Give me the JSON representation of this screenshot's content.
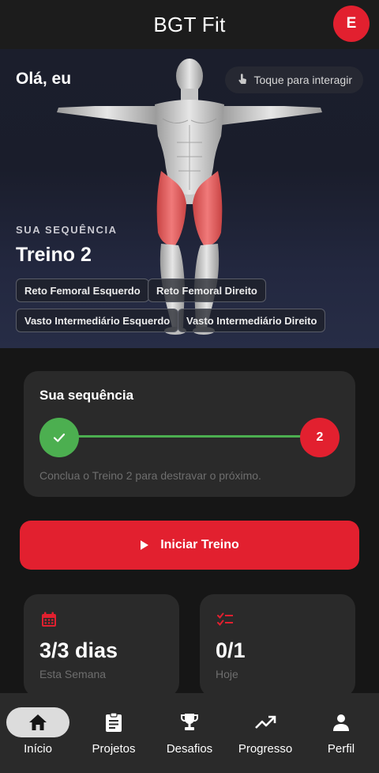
{
  "app": {
    "title": "BGT Fit",
    "avatar_initial": "E"
  },
  "hero": {
    "greeting": "Olá, eu",
    "tap_hint": "Toque para interagir",
    "sequence_label": "SUA SEQUÊNCIA",
    "workout_name": "Treino 2",
    "muscles": [
      "Reto Femoral Esquerdo",
      "Reto Femoral Direito",
      "Vasto Intermediário Esquerdo",
      "Vasto Intermediário Direito"
    ]
  },
  "sequence_card": {
    "title": "Sua sequência",
    "steps": [
      {
        "status": "done",
        "label": ""
      },
      {
        "status": "current",
        "label": "2"
      }
    ],
    "hint": "Conclua o Treino 2 para destravar o próximo."
  },
  "start_button": {
    "label": "Iniciar Treino",
    "icon": "play-icon"
  },
  "stats": [
    {
      "value": "3/3 dias",
      "label": "Esta Semana",
      "icon": "calendar-icon"
    },
    {
      "value": "0/1",
      "label": "Hoje",
      "icon": "checklist-icon"
    }
  ],
  "nav": [
    {
      "label": "Início",
      "icon": "home-icon",
      "active": true
    },
    {
      "label": "Projetos",
      "icon": "clipboard-icon",
      "active": false
    },
    {
      "label": "Desafios",
      "icon": "trophy-icon",
      "active": false
    },
    {
      "label": "Progresso",
      "icon": "trending-up-icon",
      "active": false
    },
    {
      "label": "Perfil",
      "icon": "person-icon",
      "active": false
    }
  ],
  "colors": {
    "accent": "#e2202f",
    "success": "#4caf50",
    "background": "#161616",
    "card": "#2a2a2a",
    "muted_text": "#6e6e6e"
  }
}
